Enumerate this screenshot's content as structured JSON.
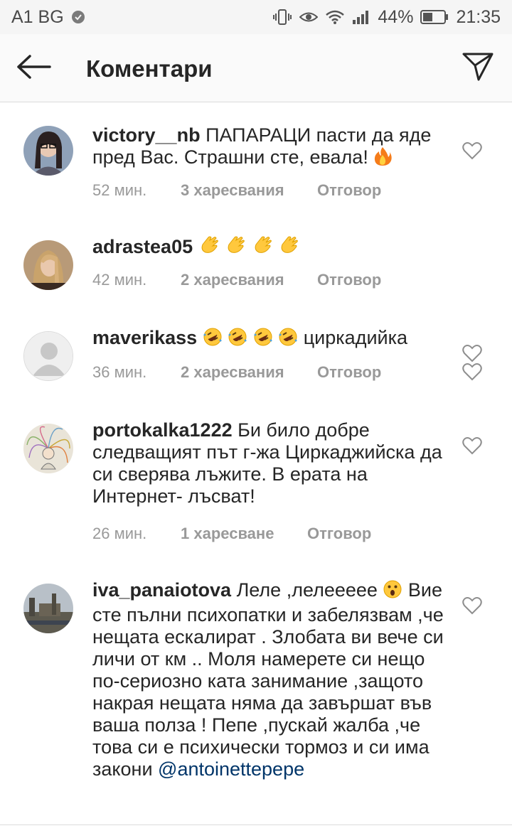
{
  "status_bar": {
    "carrier": "A1 BG",
    "battery": "44%",
    "time": "21:35"
  },
  "header": {
    "title": "Коментари",
    "back_icon": "arrow-left-icon",
    "direct_icon": "paper-plane-icon"
  },
  "comments": [
    {
      "username": "victory__nb",
      "text": " ПАПАРАЦИ пасти да яде пред Вас. Страшни сте, евала! ",
      "emoji": [
        "fire"
      ],
      "time": "52 мин.",
      "likes": "3 харесвания",
      "reply": "Отговор"
    },
    {
      "username": "adrastea05",
      "text": " ",
      "emoji": [
        "clap",
        "clap",
        "clap",
        "clap"
      ],
      "time": "42 мин.",
      "likes": "2 харесвания",
      "reply": "Отговор"
    },
    {
      "username": "maverikass",
      "text": " ",
      "emoji": [
        "rofl",
        "rofl",
        "rofl",
        "rofl"
      ],
      "text_after": " циркадийка",
      "time": "36 мин.",
      "likes": "2 харесвания",
      "reply": "Отговор"
    },
    {
      "username": "portokalka1222",
      "text": " Би било добре следващият път г-жа Циркаджийска да си сверява лъжите. В ерата на Интернет- лъсват!",
      "time": "26 мин.",
      "likes": "1 харесване",
      "reply": "Отговор"
    },
    {
      "username": "iva_panaiotova",
      "text": " Леле ,лелеееее ",
      "emoji": [
        "astonished"
      ],
      "text_after": " Вие сте пълни психопатки и забелязвам ,че нещата ескалират . Злобата ви вече си личи от км .. Моля намерете си нещо по-сериозно ката занимание ,защото накрая нещата няма да завършат във ваша полза ! Пепе ,пускай жалба ,че това си е психически тормоз и си има закони ",
      "mention": "@antoinettepepe"
    }
  ],
  "colors": {
    "text": "#262626",
    "meta": "#999999",
    "mention": "#003569",
    "divider": "#dbdbdb"
  }
}
